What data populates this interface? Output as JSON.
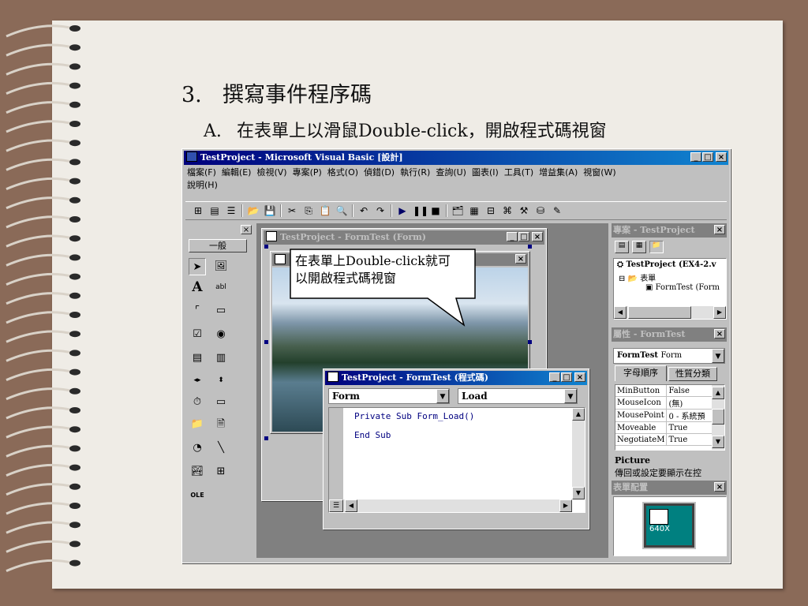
{
  "slide": {
    "heading_number": "3.",
    "heading_text": "撰寫事件程序碼",
    "sub_letter": "A.",
    "sub_text": "在表單上以滑鼠Double-click，開啟程式碼視窗",
    "callout_line1": "在表單上Double-click就可",
    "callout_line2": "以開啟程式碼視窗"
  },
  "vb": {
    "title": "TestProject - Microsoft Visual Basic [設計]",
    "menus": [
      "檔案(F)",
      "編輯(E)",
      "檢視(V)",
      "專案(P)",
      "格式(O)",
      "偵錯(D)",
      "執行(R)",
      "查詢(U)",
      "圖表(I)",
      "工具(T)",
      "增益集(A)",
      "視窗(W)"
    ],
    "menu_help": "說明(H)",
    "toolbox_tab": "一般",
    "form_title": "TestProject - FormTest (Form)",
    "code_title": "TestProject - FormTest (程式碼)",
    "code_object": "Form",
    "code_proc": "Load",
    "code_line1": "Private Sub Form_Load()",
    "code_line2": "End Sub",
    "project_title": "專案 - TestProject",
    "project_root": "TestProject (EX4-2.v",
    "project_folder": "表單",
    "project_form": "FormTest (Form",
    "props_title": "屬性 - FormTest",
    "props_object": "FormTest",
    "props_object_type": "Form",
    "props_tab_alpha": "字母順序",
    "props_tab_cat": "性質分類",
    "props": [
      {
        "name": "MinButton",
        "value": "False"
      },
      {
        "name": "MouseIcon",
        "value": "(無)"
      },
      {
        "name": "MousePoint",
        "value": "0 - 系統預"
      },
      {
        "name": "Moveable",
        "value": "True"
      },
      {
        "name": "NegotiateM",
        "value": "True"
      }
    ],
    "desc_name": "Picture",
    "desc_text": "傳回或設定要顯示在控",
    "layout_title": "表單配置",
    "layout_label": "640X"
  }
}
